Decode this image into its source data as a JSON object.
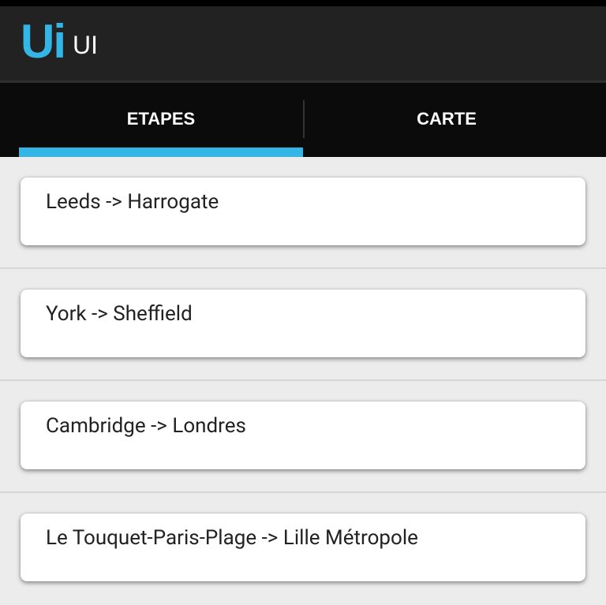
{
  "app": {
    "logo_text": "Ui",
    "title": "UI"
  },
  "tabs": [
    {
      "label": "ETAPES",
      "selected": true
    },
    {
      "label": "CARTE",
      "selected": false
    }
  ],
  "stages": [
    {
      "label": "Leeds -> Harrogate"
    },
    {
      "label": "York -> Sheffield"
    },
    {
      "label": "Cambridge -> Londres"
    },
    {
      "label": "Le Touquet-Paris-Plage -> Lille Métropole"
    }
  ],
  "colors": {
    "accent": "#33b5e5",
    "action_bar": "#222222",
    "tab_bar": "#0b0b0b",
    "background": "#ececec",
    "card": "#ffffff"
  }
}
